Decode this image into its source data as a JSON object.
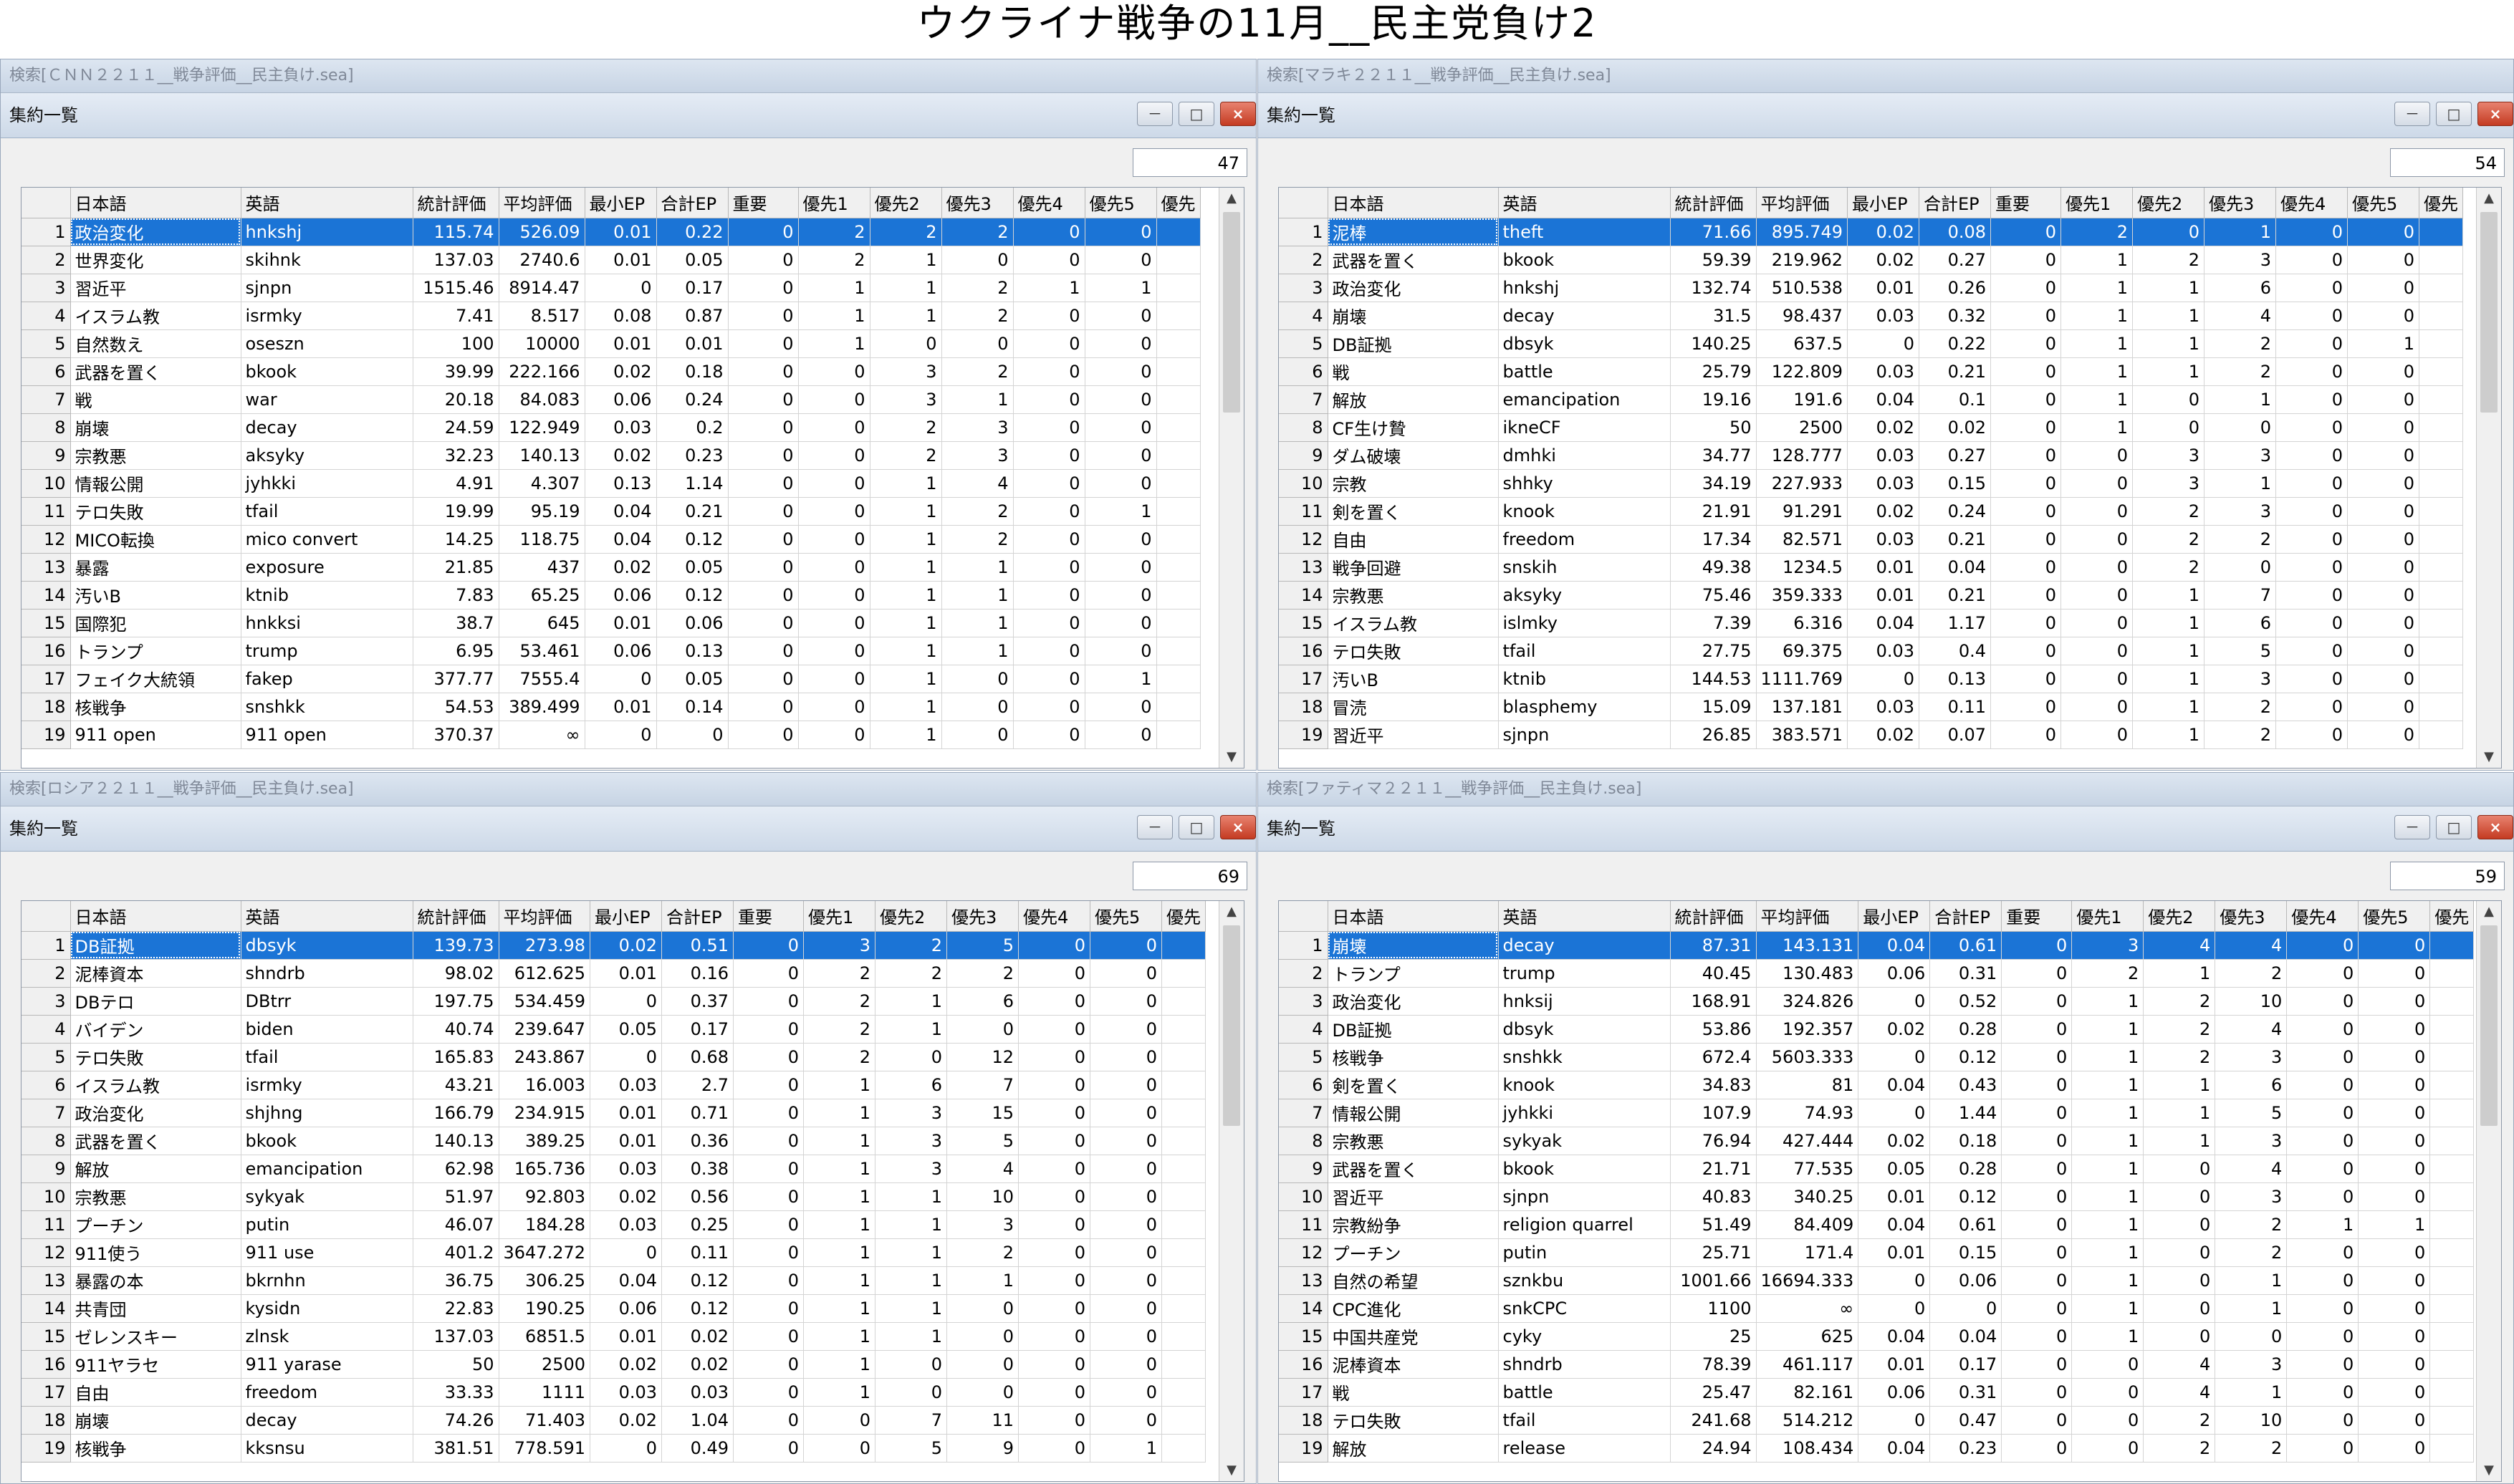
{
  "page_title": "ウクライナ戦争の11月__民主党負け2",
  "window_buttons": {
    "minimize": "－",
    "maximize": "□",
    "close": "×"
  },
  "columns": [
    "",
    "日本語",
    "英語",
    "統計評価",
    "平均評価",
    "最小EP",
    "合計EP",
    "重要",
    "優先1",
    "優先2",
    "優先3",
    "優先4",
    "優先5",
    "優先"
  ],
  "scroll": {
    "up": "▲",
    "down": "▼"
  },
  "panels": [
    {
      "search_label": "検索[ＣＮＮ２２１１__戦争評価__民主負け.sea]",
      "window_title": "集約一覧",
      "count": "47",
      "rows": [
        [
          "1",
          "政治変化",
          "hnkshj",
          "115.74",
          "526.09",
          "0.01",
          "0.22",
          "0",
          "2",
          "2",
          "2",
          "0",
          "0"
        ],
        [
          "2",
          "世界変化",
          "skihnk",
          "137.03",
          "2740.6",
          "0.01",
          "0.05",
          "0",
          "2",
          "1",
          "0",
          "0",
          "0"
        ],
        [
          "3",
          "習近平",
          "sjnpn",
          "1515.46",
          "8914.47",
          "0",
          "0.17",
          "0",
          "1",
          "1",
          "2",
          "1",
          "1"
        ],
        [
          "4",
          "イスラム教",
          "isrmky",
          "7.41",
          "8.517",
          "0.08",
          "0.87",
          "0",
          "1",
          "1",
          "2",
          "0",
          "0"
        ],
        [
          "5",
          "自然数え",
          "oseszn",
          "100",
          "10000",
          "0.01",
          "0.01",
          "0",
          "1",
          "0",
          "0",
          "0",
          "0"
        ],
        [
          "6",
          "武器を置く",
          "bkook",
          "39.99",
          "222.166",
          "0.02",
          "0.18",
          "0",
          "0",
          "3",
          "2",
          "0",
          "0"
        ],
        [
          "7",
          "戦",
          "war",
          "20.18",
          "84.083",
          "0.06",
          "0.24",
          "0",
          "0",
          "3",
          "1",
          "0",
          "0"
        ],
        [
          "8",
          "崩壊",
          "decay",
          "24.59",
          "122.949",
          "0.03",
          "0.2",
          "0",
          "0",
          "2",
          "3",
          "0",
          "0"
        ],
        [
          "9",
          "宗教悪",
          "aksyky",
          "32.23",
          "140.13",
          "0.02",
          "0.23",
          "0",
          "0",
          "2",
          "3",
          "0",
          "0"
        ],
        [
          "10",
          "情報公開",
          "jyhkki",
          "4.91",
          "4.307",
          "0.13",
          "1.14",
          "0",
          "0",
          "1",
          "4",
          "0",
          "0"
        ],
        [
          "11",
          "テロ失敗",
          "tfail",
          "19.99",
          "95.19",
          "0.04",
          "0.21",
          "0",
          "0",
          "1",
          "2",
          "0",
          "1"
        ],
        [
          "12",
          "MICO転換",
          "mico convert",
          "14.25",
          "118.75",
          "0.04",
          "0.12",
          "0",
          "0",
          "1",
          "2",
          "0",
          "0"
        ],
        [
          "13",
          "暴露",
          "exposure",
          "21.85",
          "437",
          "0.02",
          "0.05",
          "0",
          "0",
          "1",
          "1",
          "0",
          "0"
        ],
        [
          "14",
          "汚いB",
          "ktnib",
          "7.83",
          "65.25",
          "0.06",
          "0.12",
          "0",
          "0",
          "1",
          "1",
          "0",
          "0"
        ],
        [
          "15",
          "国際犯",
          "hnkksi",
          "38.7",
          "645",
          "0.01",
          "0.06",
          "0",
          "0",
          "1",
          "1",
          "0",
          "0"
        ],
        [
          "16",
          "トランプ",
          "trump",
          "6.95",
          "53.461",
          "0.06",
          "0.13",
          "0",
          "0",
          "1",
          "1",
          "0",
          "0"
        ],
        [
          "17",
          "フェイク大統領",
          "fakep",
          "377.77",
          "7555.4",
          "0",
          "0.05",
          "0",
          "0",
          "1",
          "0",
          "0",
          "1"
        ],
        [
          "18",
          "核戦争",
          "snshkk",
          "54.53",
          "389.499",
          "0.01",
          "0.14",
          "0",
          "0",
          "1",
          "0",
          "0",
          "0"
        ],
        [
          "19",
          "911 open",
          "911 open",
          "370.37",
          "∞",
          "0",
          "0",
          "0",
          "0",
          "1",
          "0",
          "0",
          "0"
        ]
      ]
    },
    {
      "search_label": "検索[マラキ２２１１__戦争評価__民主負け.sea]",
      "window_title": "集約一覧",
      "count": "54",
      "rows": [
        [
          "1",
          "泥棒",
          "theft",
          "71.66",
          "895.749",
          "0.02",
          "0.08",
          "0",
          "2",
          "0",
          "1",
          "0",
          "0"
        ],
        [
          "2",
          "武器を置く",
          "bkook",
          "59.39",
          "219.962",
          "0.02",
          "0.27",
          "0",
          "1",
          "2",
          "3",
          "0",
          "0"
        ],
        [
          "3",
          "政治変化",
          "hnkshj",
          "132.74",
          "510.538",
          "0.01",
          "0.26",
          "0",
          "1",
          "1",
          "6",
          "0",
          "0"
        ],
        [
          "4",
          "崩壊",
          "decay",
          "31.5",
          "98.437",
          "0.03",
          "0.32",
          "0",
          "1",
          "1",
          "4",
          "0",
          "0"
        ],
        [
          "5",
          "DB証拠",
          "dbsyk",
          "140.25",
          "637.5",
          "0",
          "0.22",
          "0",
          "1",
          "1",
          "2",
          "0",
          "1"
        ],
        [
          "6",
          "戦",
          "battle",
          "25.79",
          "122.809",
          "0.03",
          "0.21",
          "0",
          "1",
          "1",
          "2",
          "0",
          "0"
        ],
        [
          "7",
          "解放",
          "emancipation",
          "19.16",
          "191.6",
          "0.04",
          "0.1",
          "0",
          "1",
          "0",
          "1",
          "0",
          "0"
        ],
        [
          "8",
          "CF生け贄",
          "ikneCF",
          "50",
          "2500",
          "0.02",
          "0.02",
          "0",
          "1",
          "0",
          "0",
          "0",
          "0"
        ],
        [
          "9",
          "ダム破壊",
          "dmhki",
          "34.77",
          "128.777",
          "0.03",
          "0.27",
          "0",
          "0",
          "3",
          "3",
          "0",
          "0"
        ],
        [
          "10",
          "宗教",
          "shhky",
          "34.19",
          "227.933",
          "0.03",
          "0.15",
          "0",
          "0",
          "3",
          "1",
          "0",
          "0"
        ],
        [
          "11",
          "剣を置く",
          "knook",
          "21.91",
          "91.291",
          "0.02",
          "0.24",
          "0",
          "0",
          "2",
          "3",
          "0",
          "0"
        ],
        [
          "12",
          "自由",
          "freedom",
          "17.34",
          "82.571",
          "0.03",
          "0.21",
          "0",
          "0",
          "2",
          "2",
          "0",
          "0"
        ],
        [
          "13",
          "戦争回避",
          "snskih",
          "49.38",
          "1234.5",
          "0.01",
          "0.04",
          "0",
          "0",
          "2",
          "0",
          "0",
          "0"
        ],
        [
          "14",
          "宗教悪",
          "aksyky",
          "75.46",
          "359.333",
          "0.01",
          "0.21",
          "0",
          "0",
          "1",
          "7",
          "0",
          "0"
        ],
        [
          "15",
          "イスラム教",
          "islmky",
          "7.39",
          "6.316",
          "0.04",
          "1.17",
          "0",
          "0",
          "1",
          "6",
          "0",
          "0"
        ],
        [
          "16",
          "テロ失敗",
          "tfail",
          "27.75",
          "69.375",
          "0.03",
          "0.4",
          "0",
          "0",
          "1",
          "5",
          "0",
          "0"
        ],
        [
          "17",
          "汚いB",
          "ktnib",
          "144.53",
          "1111.769",
          "0",
          "0.13",
          "0",
          "0",
          "1",
          "3",
          "0",
          "0"
        ],
        [
          "18",
          "冒涜",
          "blasphemy",
          "15.09",
          "137.181",
          "0.03",
          "0.11",
          "0",
          "0",
          "1",
          "2",
          "0",
          "0"
        ],
        [
          "19",
          "習近平",
          "sjnpn",
          "26.85",
          "383.571",
          "0.02",
          "0.07",
          "0",
          "0",
          "1",
          "2",
          "0",
          "0"
        ]
      ]
    },
    {
      "search_label": "検索[ロシア２２１１__戦争評価__民主負け.sea]",
      "window_title": "集約一覧",
      "count": "69",
      "rows": [
        [
          "1",
          "DB証拠",
          "dbsyk",
          "139.73",
          "273.98",
          "0.02",
          "0.51",
          "0",
          "3",
          "2",
          "5",
          "0",
          "0"
        ],
        [
          "2",
          "泥棒資本",
          "shndrb",
          "98.02",
          "612.625",
          "0.01",
          "0.16",
          "0",
          "2",
          "2",
          "2",
          "0",
          "0"
        ],
        [
          "3",
          "DBテロ",
          "DBtrr",
          "197.75",
          "534.459",
          "0",
          "0.37",
          "0",
          "2",
          "1",
          "6",
          "0",
          "0"
        ],
        [
          "4",
          "バイデン",
          "biden",
          "40.74",
          "239.647",
          "0.05",
          "0.17",
          "0",
          "2",
          "1",
          "0",
          "0",
          "0"
        ],
        [
          "5",
          "テロ失敗",
          "tfail",
          "165.83",
          "243.867",
          "0",
          "0.68",
          "0",
          "2",
          "0",
          "12",
          "0",
          "0"
        ],
        [
          "6",
          "イスラム教",
          "isrmky",
          "43.21",
          "16.003",
          "0.03",
          "2.7",
          "0",
          "1",
          "6",
          "7",
          "0",
          "0"
        ],
        [
          "7",
          "政治変化",
          "shjhng",
          "166.79",
          "234.915",
          "0.01",
          "0.71",
          "0",
          "1",
          "3",
          "15",
          "0",
          "0"
        ],
        [
          "8",
          "武器を置く",
          "bkook",
          "140.13",
          "389.25",
          "0.01",
          "0.36",
          "0",
          "1",
          "3",
          "5",
          "0",
          "0"
        ],
        [
          "9",
          "解放",
          "emancipation",
          "62.98",
          "165.736",
          "0.03",
          "0.38",
          "0",
          "1",
          "3",
          "4",
          "0",
          "0"
        ],
        [
          "10",
          "宗教悪",
          "sykyak",
          "51.97",
          "92.803",
          "0.02",
          "0.56",
          "0",
          "1",
          "1",
          "10",
          "0",
          "0"
        ],
        [
          "11",
          "プーチン",
          "putin",
          "46.07",
          "184.28",
          "0.03",
          "0.25",
          "0",
          "1",
          "1",
          "3",
          "0",
          "0"
        ],
        [
          "12",
          "911使う",
          "911 use",
          "401.2",
          "3647.272",
          "0",
          "0.11",
          "0",
          "1",
          "1",
          "2",
          "0",
          "0"
        ],
        [
          "13",
          "暴露の本",
          "bkrnhn",
          "36.75",
          "306.25",
          "0.04",
          "0.12",
          "0",
          "1",
          "1",
          "1",
          "0",
          "0"
        ],
        [
          "14",
          "共青団",
          "kysidn",
          "22.83",
          "190.25",
          "0.06",
          "0.12",
          "0",
          "1",
          "1",
          "0",
          "0",
          "0"
        ],
        [
          "15",
          "ゼレンスキー",
          "zlnsk",
          "137.03",
          "6851.5",
          "0.01",
          "0.02",
          "0",
          "1",
          "1",
          "0",
          "0",
          "0"
        ],
        [
          "16",
          "911ヤラセ",
          "911 yarase",
          "50",
          "2500",
          "0.02",
          "0.02",
          "0",
          "1",
          "0",
          "0",
          "0",
          "0"
        ],
        [
          "17",
          "自由",
          "freedom",
          "33.33",
          "1111",
          "0.03",
          "0.03",
          "0",
          "1",
          "0",
          "0",
          "0",
          "0"
        ],
        [
          "18",
          "崩壊",
          "decay",
          "74.26",
          "71.403",
          "0.02",
          "1.04",
          "0",
          "0",
          "7",
          "11",
          "0",
          "0"
        ],
        [
          "19",
          "核戦争",
          "kksnsu",
          "381.51",
          "778.591",
          "0",
          "0.49",
          "0",
          "0",
          "5",
          "9",
          "0",
          "1"
        ]
      ]
    },
    {
      "search_label": "検索[ファティマ２２１１__戦争評価__民主負け.sea]",
      "window_title": "集約一覧",
      "count": "59",
      "rows": [
        [
          "1",
          "崩壊",
          "decay",
          "87.31",
          "143.131",
          "0.04",
          "0.61",
          "0",
          "3",
          "4",
          "4",
          "0",
          "0"
        ],
        [
          "2",
          "トランプ",
          "trump",
          "40.45",
          "130.483",
          "0.06",
          "0.31",
          "0",
          "2",
          "1",
          "2",
          "0",
          "0"
        ],
        [
          "3",
          "政治変化",
          "hnksij",
          "168.91",
          "324.826",
          "0",
          "0.52",
          "0",
          "1",
          "2",
          "10",
          "0",
          "0"
        ],
        [
          "4",
          "DB証拠",
          "dbsyk",
          "53.86",
          "192.357",
          "0.02",
          "0.28",
          "0",
          "1",
          "2",
          "4",
          "0",
          "0"
        ],
        [
          "5",
          "核戦争",
          "snshkk",
          "672.4",
          "5603.333",
          "0",
          "0.12",
          "0",
          "1",
          "2",
          "3",
          "0",
          "0"
        ],
        [
          "6",
          "剣を置く",
          "knook",
          "34.83",
          "81",
          "0.04",
          "0.43",
          "0",
          "1",
          "1",
          "6",
          "0",
          "0"
        ],
        [
          "7",
          "情報公開",
          "jyhkki",
          "107.9",
          "74.93",
          "0",
          "1.44",
          "0",
          "1",
          "1",
          "5",
          "0",
          "0"
        ],
        [
          "8",
          "宗教悪",
          "sykyak",
          "76.94",
          "427.444",
          "0.02",
          "0.18",
          "0",
          "1",
          "1",
          "3",
          "0",
          "0"
        ],
        [
          "9",
          "武器を置く",
          "bkook",
          "21.71",
          "77.535",
          "0.05",
          "0.28",
          "0",
          "1",
          "0",
          "4",
          "0",
          "0"
        ],
        [
          "10",
          "習近平",
          "sjnpn",
          "40.83",
          "340.25",
          "0.01",
          "0.12",
          "0",
          "1",
          "0",
          "3",
          "0",
          "0"
        ],
        [
          "11",
          "宗教紛争",
          "religion quarrel",
          "51.49",
          "84.409",
          "0.04",
          "0.61",
          "0",
          "1",
          "0",
          "2",
          "1",
          "1"
        ],
        [
          "12",
          "プーチン",
          "putin",
          "25.71",
          "171.4",
          "0.01",
          "0.15",
          "0",
          "1",
          "0",
          "2",
          "0",
          "0"
        ],
        [
          "13",
          "自然の希望",
          "sznkbu",
          "1001.66",
          "16694.333",
          "0",
          "0.06",
          "0",
          "1",
          "0",
          "1",
          "0",
          "0"
        ],
        [
          "14",
          "CPC進化",
          "snkCPC",
          "1100",
          "∞",
          "0",
          "0",
          "0",
          "1",
          "0",
          "1",
          "0",
          "0"
        ],
        [
          "15",
          "中国共産党",
          "cyky",
          "25",
          "625",
          "0.04",
          "0.04",
          "0",
          "1",
          "0",
          "0",
          "0",
          "0"
        ],
        [
          "16",
          "泥棒資本",
          "shndrb",
          "78.39",
          "461.117",
          "0.01",
          "0.17",
          "0",
          "0",
          "4",
          "3",
          "0",
          "0"
        ],
        [
          "17",
          "戦",
          "battle",
          "25.47",
          "82.161",
          "0.06",
          "0.31",
          "0",
          "0",
          "4",
          "1",
          "0",
          "0"
        ],
        [
          "18",
          "テロ失敗",
          "tfail",
          "241.68",
          "514.212",
          "0",
          "0.47",
          "0",
          "0",
          "2",
          "10",
          "0",
          "0"
        ],
        [
          "19",
          "解放",
          "release",
          "24.94",
          "108.434",
          "0.04",
          "0.23",
          "0",
          "0",
          "2",
          "2",
          "0",
          "0"
        ]
      ]
    }
  ]
}
